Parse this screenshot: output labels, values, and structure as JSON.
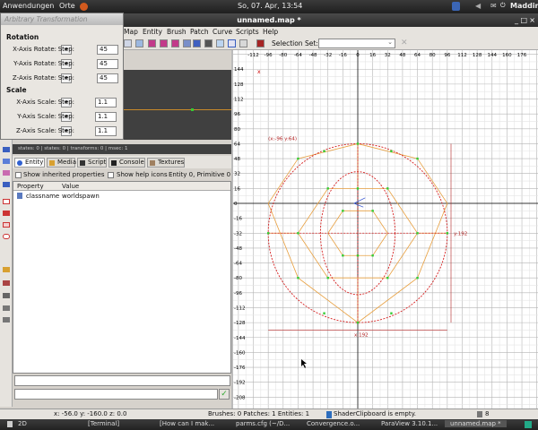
{
  "system_panel": {
    "applications": "Anwendungen",
    "places": "Orte",
    "clock": "So, 07. Apr, 13:54",
    "user": "Maddin"
  },
  "window": {
    "title": "unnamed.map *"
  },
  "menu": {
    "items": [
      "Map",
      "Entity",
      "Brush",
      "Patch",
      "Curve",
      "Scripts",
      "Help"
    ]
  },
  "toolbar": {
    "selection_set_label": "Selection Set:",
    "selection_set_value": ""
  },
  "transform_dialog": {
    "title": "Arbitrary Transformation",
    "rotation_heading": "Rotation",
    "scale_heading": "Scale",
    "step_label": "Step:",
    "rotation": [
      {
        "label": "X-Axis Rotate:",
        "step": "45"
      },
      {
        "label": "Y-Axis Rotate:",
        "step": "45"
      },
      {
        "label": "Z-Axis Rotate:",
        "step": "45"
      }
    ],
    "scale": [
      {
        "label": "X-Axis Scale:",
        "step": "1.1"
      },
      {
        "label": "Y-Axis Scale:",
        "step": "1.1"
      },
      {
        "label": "Z-Axis Scale:",
        "step": "1.1"
      }
    ]
  },
  "camera_status": "states: 0 | states: 0 | transforms: 0 | msec: 1",
  "inspector": {
    "tabs": [
      "Entity",
      "Media",
      "Script",
      "Console",
      "Textures"
    ],
    "show_inherited": "Show inherited properties",
    "show_help_icons": "Show help icons",
    "entity_info": "Entity 0, Primitive 0",
    "columns": [
      "Property",
      "Value"
    ],
    "rows": [
      {
        "property": "classname",
        "value": "worldspawn"
      }
    ]
  },
  "status_bar": {
    "coords": "x:  -56.0  y: -160.0  z:      0.0",
    "counts": "Brushes: 0 Patches: 1 Entities: 1",
    "shader": "ShaderClipboard is empty.",
    "grid": "8"
  },
  "taskbar": {
    "items": [
      "2D",
      "[Terminal]",
      "[How can I mak...",
      "parms.cfg (~/D...",
      "Convergence.o...",
      "ParaView 3.10.1...",
      "unnamed.map *"
    ]
  },
  "ortho_view": {
    "x_ticks": [
      "-112",
      "-96",
      "-80",
      "-64",
      "-48",
      "-32",
      "-16",
      "0",
      "16",
      "32",
      "48",
      "64",
      "80",
      "96",
      "112",
      "128",
      "144",
      "160",
      "176"
    ],
    "y_ticks": [
      "144",
      "128",
      "112",
      "96",
      "80",
      "64",
      "48",
      "32",
      "16",
      "0",
      "-16",
      "-32",
      "-48",
      "-64",
      "-80",
      "-96",
      "-112",
      "-128",
      "-144",
      "-160",
      "-176",
      "-192",
      "-208"
    ],
    "origin_label": "x",
    "corner_label": "(x:-96  y:64)",
    "width_label": "x:192",
    "height_label": "y:192",
    "colors": {
      "grid_minor": "#e4e4e4",
      "grid_major": "#b4b4b4",
      "axis": "#000000",
      "brush_edge": "#e8a040",
      "patch_curve": "#d62020",
      "vertex": "#33cc33",
      "size_line": "#b02020"
    }
  }
}
